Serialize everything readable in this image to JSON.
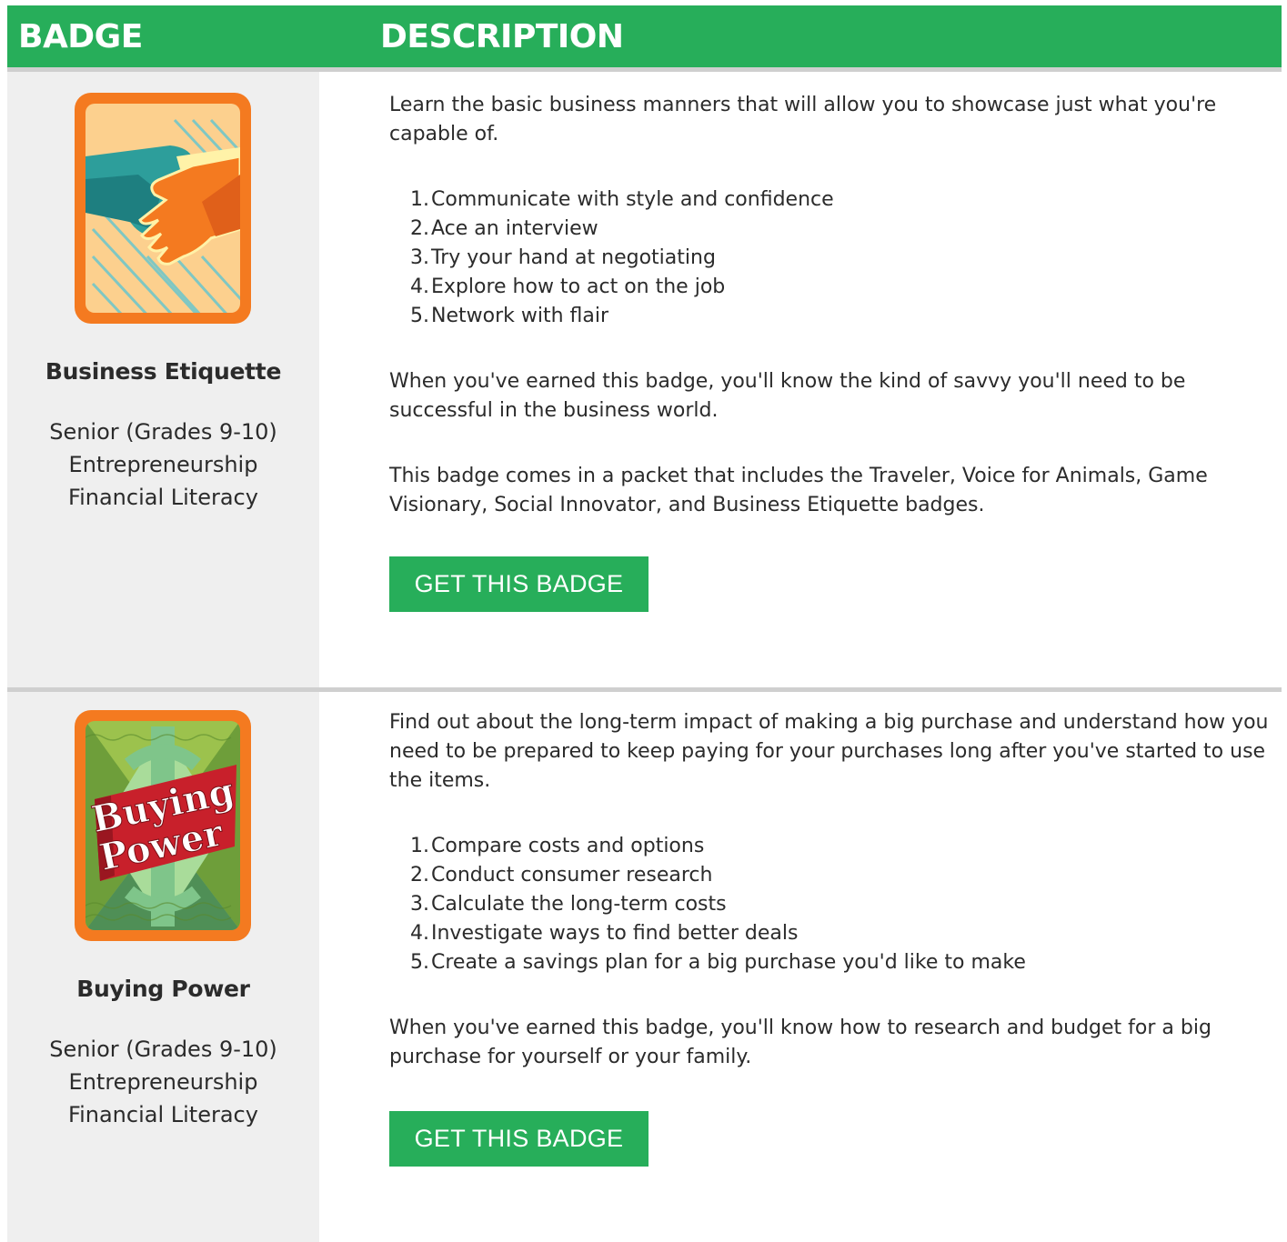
{
  "header": {
    "badge_label": "BADGE",
    "description_label": "DESCRIPTION"
  },
  "colors": {
    "header_green": "#27ae5a",
    "button_green": "#27ae5a",
    "left_panel_gray": "#efefef",
    "divider_gray": "#cfcfcf",
    "badge_border_orange": "#f47a20"
  },
  "badges": [
    {
      "name": "Business Etiquette",
      "icon": "handshake-icon",
      "meta": [
        "Senior (Grades 9-10)",
        "Entrepreneurship",
        "Financial Literacy"
      ],
      "intro": "Learn the basic business manners that will allow you to showcase just what you're capable of.",
      "steps": [
        {
          "n": "1.",
          "text": "Communicate with style and confidence"
        },
        {
          "n": "2.",
          "text": "Ace an interview"
        },
        {
          "n": "3.",
          "text": "Try your hand at negotiating"
        },
        {
          "n": "4.",
          "text": "Explore how to act on the job"
        },
        {
          "n": "5.",
          "text": "Network with flair"
        }
      ],
      "outcome": "When you've earned this badge, you'll know the kind of savvy you'll need to be successful in the business world.",
      "packet": "This badge comes in a packet that includes the Traveler, Voice for Animals, Game Visionary, Social Innovator, and Business Etiquette badges.",
      "cta": "GET THIS BADGE"
    },
    {
      "name": "Buying Power",
      "icon": "buying-power-banner-icon",
      "art_text": [
        "Buying",
        "Power"
      ],
      "meta": [
        "Senior (Grades 9-10)",
        "Entrepreneurship",
        "Financial Literacy"
      ],
      "intro": "Find out about the long-term impact of making a big purchase and understand how you need to be prepared to keep paying for your purchases long after you've started to use the items.",
      "steps": [
        {
          "n": "1.",
          "text": "Compare costs and options"
        },
        {
          "n": "2.",
          "text": "Conduct consumer research"
        },
        {
          "n": "3.",
          "text": "Calculate the long-term costs"
        },
        {
          "n": "4.",
          "text": "Investigate ways to find better deals"
        },
        {
          "n": "5.",
          "text": "Create a savings plan for a big purchase you'd like to make"
        }
      ],
      "outcome": "When you've earned this badge, you'll know how to research and budget for a big purchase for yourself or your family.",
      "cta": "GET THIS BADGE"
    }
  ]
}
